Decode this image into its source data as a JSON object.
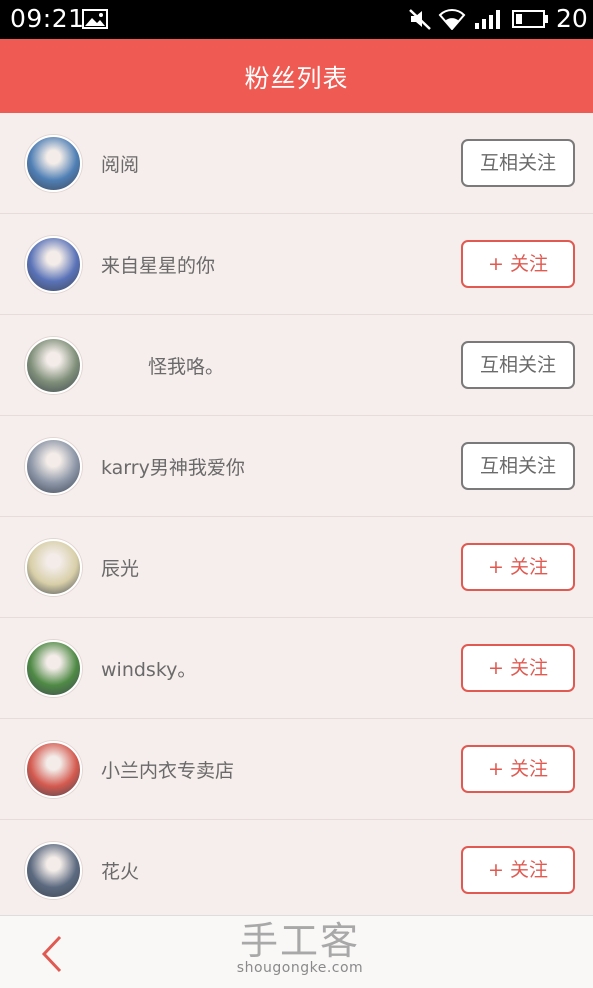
{
  "status_bar": {
    "time": "09:21",
    "battery": "20",
    "icons": [
      "gallery-icon",
      "mute-icon",
      "wifi-icon",
      "signal-icon",
      "battery-icon"
    ]
  },
  "header": {
    "title": "粉丝列表"
  },
  "fans": [
    {
      "name": "阅阅",
      "button": "互相关注",
      "state": "mutual",
      "avatar_color": "#4f7fb5"
    },
    {
      "name": "来自星星的你",
      "button": "+ 关注",
      "state": "follow",
      "avatar_color": "#5a73b8"
    },
    {
      "name": "怪我咯。",
      "button": "互相关注",
      "state": "mutual",
      "avatar_color": "#7f8f79"
    },
    {
      "name": "karry男神我爱你",
      "button": "互相关注",
      "state": "mutual",
      "avatar_color": "#8b95a6"
    },
    {
      "name": "辰光",
      "button": "+ 关注",
      "state": "follow",
      "avatar_color": "#d8cfa8"
    },
    {
      "name": "windsky。",
      "button": "+ 关注",
      "state": "follow",
      "avatar_color": "#4f8a45"
    },
    {
      "name": "小兰内衣专卖店",
      "button": "+ 关注",
      "state": "follow",
      "avatar_color": "#d45a4f"
    },
    {
      "name": "花火",
      "button": "+ 关注",
      "state": "follow",
      "avatar_color": "#5c6a80"
    }
  ],
  "bottom_bar": {
    "back_icon": "chevron-left-icon"
  },
  "watermark": {
    "logo": "手工客",
    "domain": "shougongke.com"
  },
  "colors": {
    "accent": "#ef5a52",
    "background": "#f6eeec"
  }
}
